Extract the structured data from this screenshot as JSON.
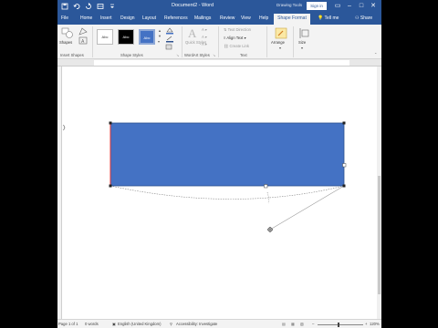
{
  "window": {
    "doc_title": "Document2 - Word",
    "drawing_tools": "Drawing Tools",
    "sign_in": "Sign in"
  },
  "tabs": [
    "File",
    "Home",
    "Insert",
    "Design",
    "Layout",
    "References",
    "Mailings",
    "Review",
    "View",
    "Help"
  ],
  "active_tab": "Shape Format",
  "tell_me": "Tell me",
  "share": "Share",
  "ribbon": {
    "insert_shapes": {
      "shapes_label": "Shapes",
      "group_label": "Insert Shapes"
    },
    "shape_styles": {
      "swatch_label": "Abc",
      "group_label": "Shape Styles"
    },
    "wordart_styles": {
      "quick_styles": "Quick Styles",
      "group_label": "WordArt Styles"
    },
    "text": {
      "text_direction": "Text Direction",
      "align_text": "Align Text",
      "create_link": "Create Link",
      "group_label": "Text"
    },
    "arrange": {
      "label": "Arrange"
    },
    "size": {
      "label": "Size"
    }
  },
  "status": {
    "page": "Page 1 of 1",
    "words": "0 words",
    "language": "English (United Kingdom)",
    "accessibility": "Accessibility: Investigate",
    "zoom": "120%"
  },
  "colors": {
    "accent": "#2b579a",
    "shape_fill": "#4472c4",
    "shape_outline": "#2f528f",
    "selected_edge": "#e03030"
  }
}
